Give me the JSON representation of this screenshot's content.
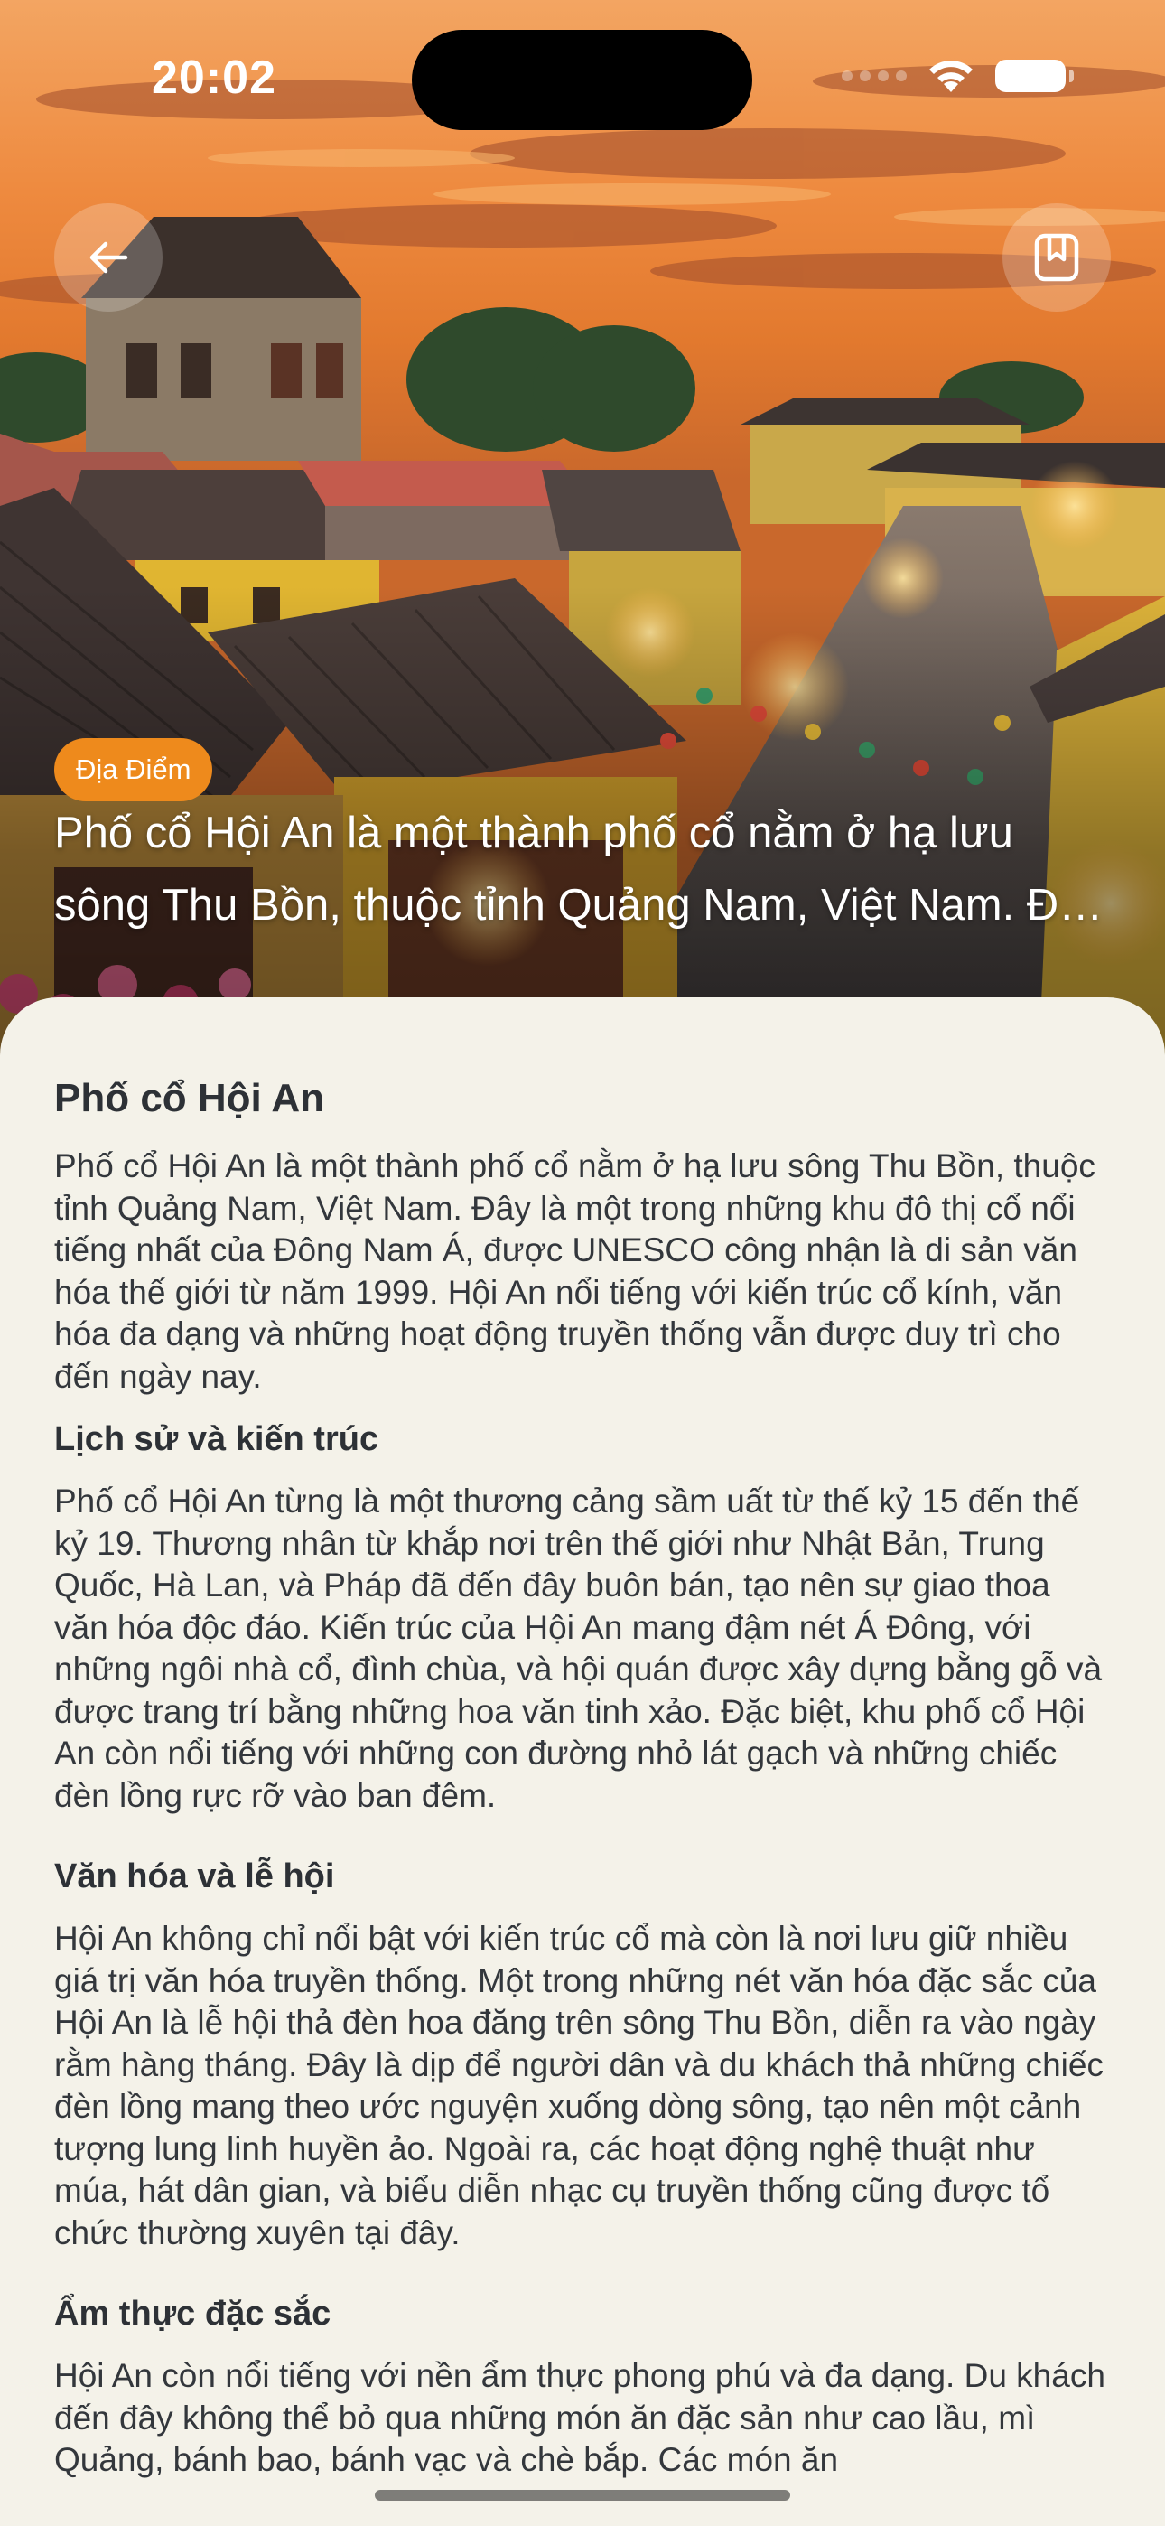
{
  "status_bar": {
    "time": "20:02"
  },
  "hero": {
    "tag": "Địa Điểm",
    "caption": "Phố cổ Hội An là một thành phố cổ nằm ở hạ lưu sông Thu Bồn, thuộc tỉnh Quảng Nam, Việt Nam. Đây là một trong những khu đô thị cổ nổi tiếng nhất của Đông Nam Á"
  },
  "icons": {
    "back": "arrow-left-icon",
    "bookmark": "bookmark-icon",
    "wifi": "wifi-icon",
    "battery": "battery-icon"
  },
  "colors": {
    "accent": "#ee8a1c",
    "background": "#f4f2e9",
    "text": "#2d3136"
  },
  "article": {
    "title": "Phố cổ Hội An",
    "intro": "Phố cổ Hội An là một thành phố cổ nằm ở hạ lưu sông Thu Bồn, thuộc tỉnh Quảng Nam, Việt Nam. Đây là một trong những khu đô thị cổ nổi tiếng nhất của Đông Nam Á, được UNESCO công nhận là di sản văn hóa thế giới từ năm 1999. Hội An nổi tiếng với kiến trúc cổ kính, văn hóa đa dạng và những hoạt động truyền thống vẫn được duy trì cho đến ngày nay.",
    "sections": [
      {
        "heading": "Lịch sử và kiến trúc",
        "body": "Phố cổ Hội An từng là một thương cảng sầm uất từ thế kỷ 15 đến thế kỷ 19. Thương nhân từ khắp nơi trên thế giới như Nhật Bản, Trung Quốc, Hà Lan, và Pháp đã đến đây buôn bán, tạo nên sự giao thoa văn hóa độc đáo. Kiến trúc của Hội An mang đậm nét Á Đông, với những ngôi nhà cổ, đình chùa, và hội quán được xây dựng bằng gỗ và được trang trí bằng những hoa văn tinh xảo. Đặc biệt, khu phố cổ Hội An còn nổi tiếng với những con đường nhỏ lát gạch và những chiếc đèn lồng rực rỡ vào ban đêm."
      },
      {
        "heading": "Văn hóa và lễ hội",
        "body": "Hội An không chỉ nổi bật với kiến trúc cổ mà còn là nơi lưu giữ nhiều giá trị văn hóa truyền thống. Một trong những nét văn hóa đặc sắc của Hội An là lễ hội thả đèn hoa đăng trên sông Thu Bồn, diễn ra vào ngày rằm hàng tháng. Đây là dịp để người dân và du khách thả những chiếc đèn lồng mang theo ước nguyện xuống dòng sông, tạo nên một cảnh tượng lung linh huyền ảo. Ngoài ra, các hoạt động nghệ thuật như múa, hát dân gian, và biểu diễn nhạc cụ truyền thống cũng được tổ chức thường xuyên tại đây."
      },
      {
        "heading": "Ẩm thực đặc sắc",
        "body": "Hội An còn nổi tiếng với nền ẩm thực phong phú và đa dạng. Du khách đến đây không thể bỏ qua những món ăn đặc sản như cao lầu, mì Quảng, bánh bao, bánh vạc và chè bắp. Các món ăn"
      }
    ]
  }
}
